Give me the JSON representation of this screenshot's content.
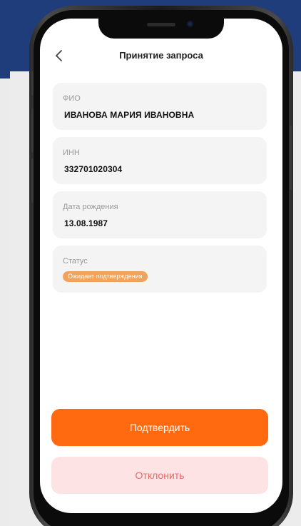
{
  "header": {
    "title": "Принятие запроса",
    "back_icon": "chevron-left-icon"
  },
  "fields": {
    "fio": {
      "label": "ФИО",
      "value": "ИВАНОВА МАРИЯ ИВАНОВНА"
    },
    "inn": {
      "label": "ИНН",
      "value": "332701020304"
    },
    "birth": {
      "label": "Дата рождения",
      "value": "13.08.1987"
    },
    "status": {
      "label": "Статус",
      "value": "Ожидает подтверждения"
    }
  },
  "actions": {
    "confirm_label": "Подтвердить",
    "reject_label": "Отклонить"
  },
  "colors": {
    "background_top": "#1f3d7a",
    "accent": "#ff6a10",
    "reject_bg": "#fde3e3",
    "reject_text": "#e46a6a",
    "status_badge": "#f0a35c"
  }
}
